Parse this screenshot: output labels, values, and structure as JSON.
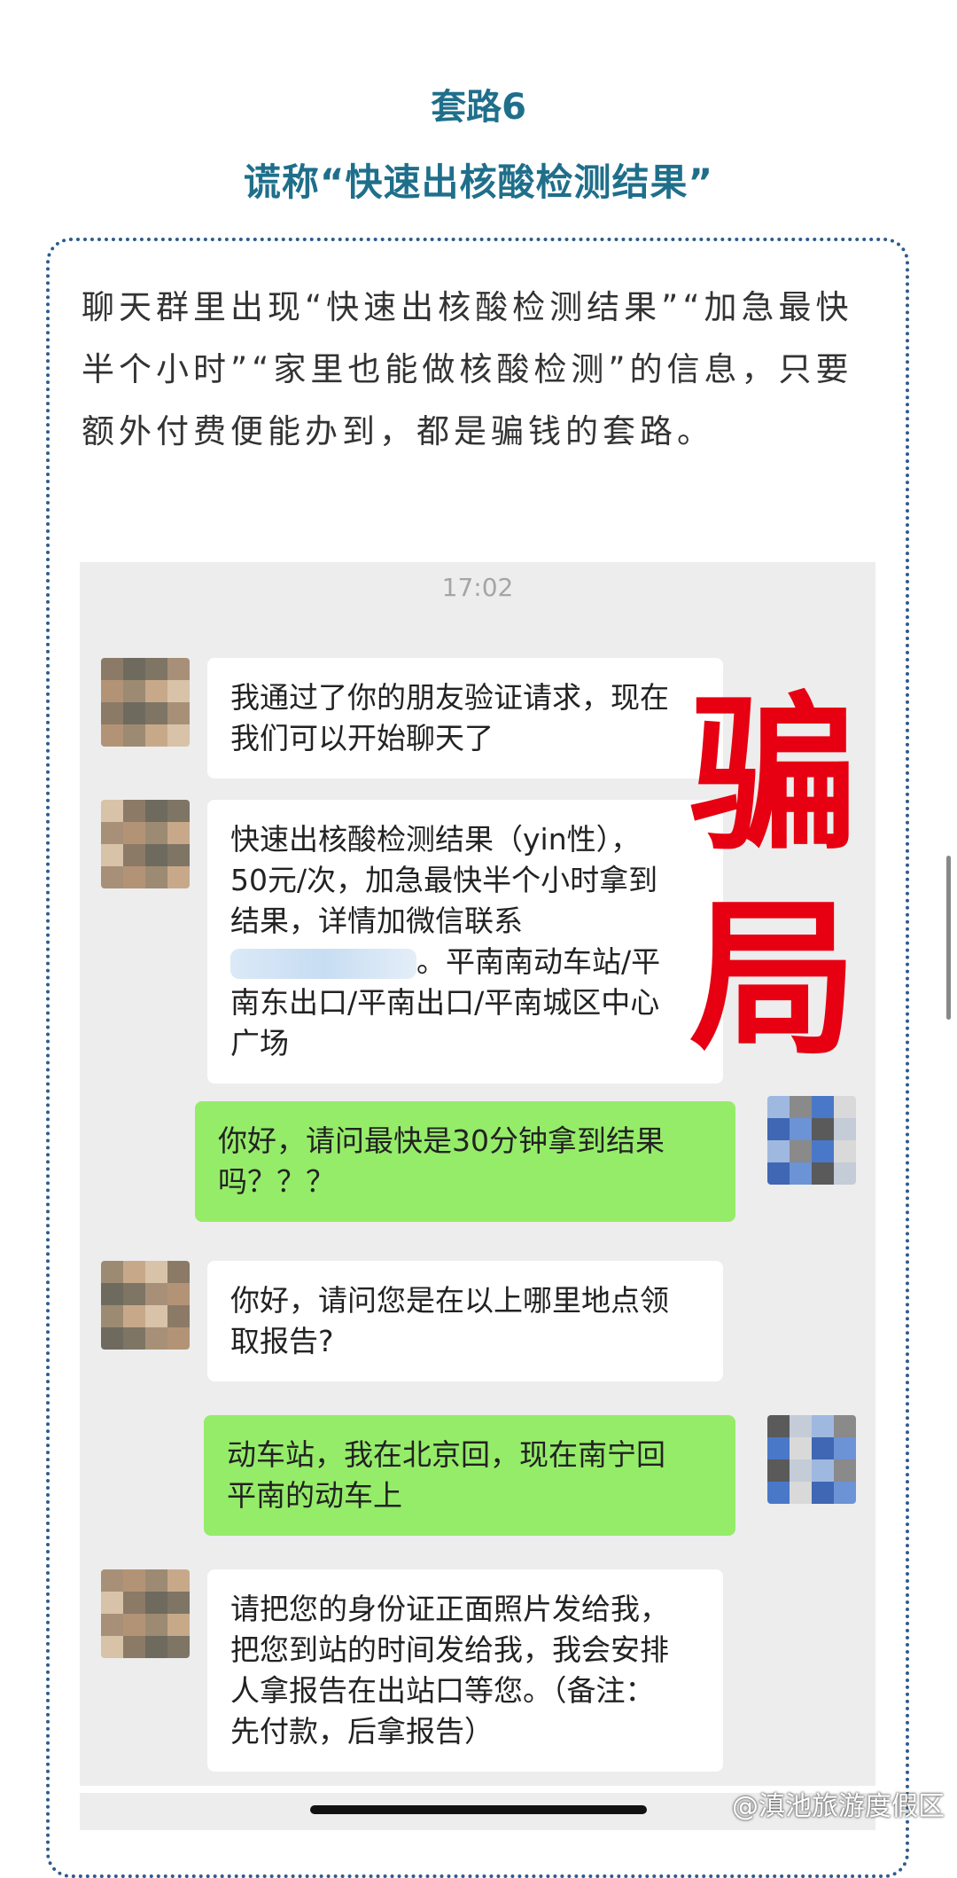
{
  "header": {
    "title": "套路6",
    "subtitle": "谎称“快速出核酸检测结果”"
  },
  "intro": {
    "text": "聊天群里出现“快速出核酸检测结果”“加急最快半个小时”“家里也能做核酸检测”的信息，只要额外付费便能办到，都是骗钱的套路。"
  },
  "chat": {
    "timestamp": "17:02",
    "messages": [
      {
        "from": "other",
        "lines": [
          "我通过了你的朋友验证请求，现在",
          "我们可以开始聊天了"
        ]
      },
      {
        "from": "other",
        "lines": [
          "快速出核酸检测结果（yin性），",
          "50元/次，加急最快半个小时拿到",
          "结果，详情加微信联系",
          "。平南南动车站/平",
          "南东出口/平南出口/平南城区中心",
          "广场"
        ]
      },
      {
        "from": "self",
        "lines": [
          "你好，请问最快是30分钟拿到结果",
          "吗？？？"
        ]
      },
      {
        "from": "other",
        "lines": [
          "你好，请问您是在以上哪里地点领",
          "取报告?"
        ]
      },
      {
        "from": "self",
        "lines": [
          "动车站，我在北京回，现在南宁回",
          "平南的动车上"
        ]
      },
      {
        "from": "other",
        "lines": [
          "请把您的身份证正面照片发给我，",
          "把您到站的时间发给我，我会安排",
          "人拿报告在出站口等您。（备注：",
          "先付款，后拿报告）"
        ]
      }
    ]
  },
  "stamp": {
    "line1": "骗",
    "line2": "局",
    "color": "#e60012"
  },
  "watermark": "@滇池旅游度假区",
  "colors": {
    "accent": "#1f6f8b",
    "bubble_self": "#95ec69",
    "bubble_other": "#ffffff",
    "chat_bg": "#ededed"
  }
}
